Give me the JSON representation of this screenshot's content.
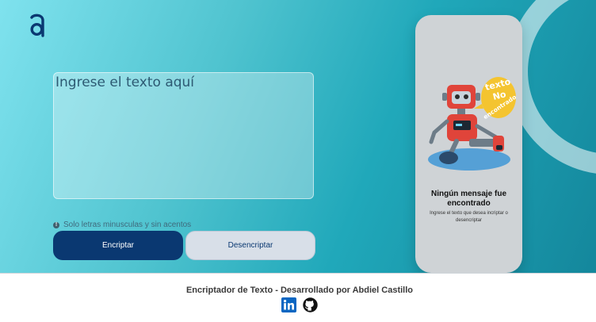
{
  "brand": {
    "logo_icon": "alura-logo-icon"
  },
  "input": {
    "placeholder": "Ingrese el texto aquí",
    "value": ""
  },
  "hint": {
    "icon": "info-icon",
    "text": "Solo letras minusculas y sin acentos"
  },
  "buttons": {
    "encrypt_label": "Encriptar",
    "decrypt_label": "Desencriptar"
  },
  "result": {
    "image_icon": "robot-illustration",
    "bubble_text": "texto No encontrado",
    "title": "Ningún mensaje fue encontrado",
    "subtitle": "Ingrese el texto que desea incriptar o desencriptar"
  },
  "footer": {
    "text": "Encriptador de Texto - Desarrollado por Abdiel Castillo",
    "links": [
      {
        "icon": "linkedin-icon"
      },
      {
        "icon": "github-icon"
      }
    ]
  },
  "colors": {
    "primary": "#0a3871",
    "secondary_button": "#d8dfe8",
    "background_start": "#7fe2ee",
    "background_end": "#14879c",
    "panel": "#cfd3d6",
    "linkedin": "#0a66c2"
  }
}
